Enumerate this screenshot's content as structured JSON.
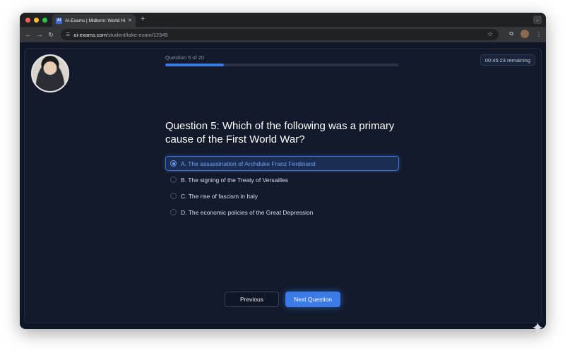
{
  "browser": {
    "tab_title": "AI-Exams | Midterm: World His",
    "favicon_text": "AI",
    "tab_close": "✕",
    "new_tab": "+",
    "url_host": "ai-exams.com",
    "url_path": "/student/take-exam/12345"
  },
  "exam": {
    "progress_label": "Question 5 of 20",
    "progress_fraction": 0.25,
    "timer": "00:45:23 remaining",
    "question": "Question 5: Which of the following was a primary cause of the First World War?",
    "options": [
      {
        "label": "A. The assassination of Archduke Franz Ferdinand",
        "selected": true
      },
      {
        "label": "B. The signing of the Treaty of Versailles",
        "selected": false
      },
      {
        "label": "C. The rise of fascism in Italy",
        "selected": false
      },
      {
        "label": "D. The economic policies of the Great Depression",
        "selected": false
      }
    ],
    "previous_label": "Previous",
    "next_label": "Next Question"
  },
  "colors": {
    "accent": "#3b7be8",
    "page_bg": "#121a2b",
    "selected_text": "#6ea1f4"
  }
}
